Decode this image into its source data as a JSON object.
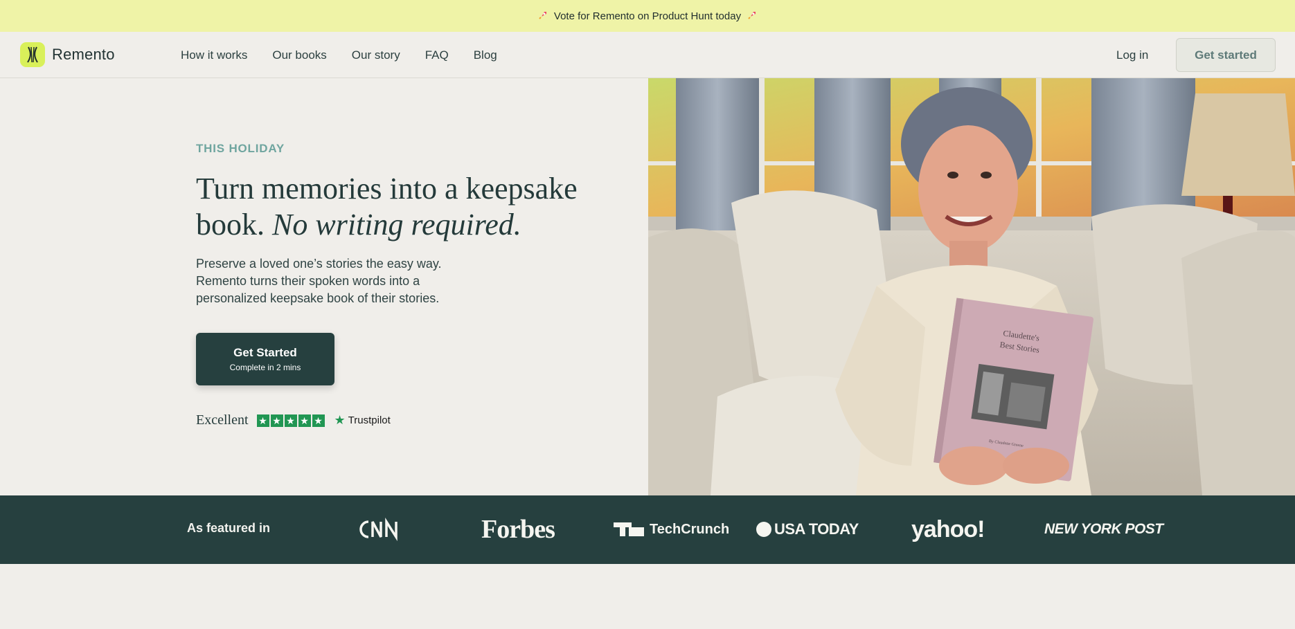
{
  "banner": {
    "text": "Vote for Remento on Product Hunt today"
  },
  "header": {
    "brand": "Remento",
    "nav": [
      "How it works",
      "Our books",
      "Our story",
      "FAQ",
      "Blog"
    ],
    "login": "Log in",
    "cta": "Get started"
  },
  "hero": {
    "eyebrow": "THIS HOLIDAY",
    "headline_plain": "Turn memories into a keepsake book.",
    "headline_italic": "No writing required.",
    "subtext": "Preserve a loved one’s stories the easy way. Remento turns their spoken words into a personalized keepsake book of their stories.",
    "cta_title": "Get Started",
    "cta_sub": "Complete in 2 mins",
    "rating_label": "Excellent",
    "rating_stars": 5,
    "rating_source": "Trustpilot",
    "book_title": "Claudette's Best Stories",
    "book_byline": "By Claudette Greene"
  },
  "featured": {
    "label": "As featured in",
    "outlets": [
      "CNN",
      "Forbes",
      "TechCrunch",
      "USA TODAY",
      "yahoo!",
      "NEW YORK POST"
    ]
  },
  "colors": {
    "banner_bg": "#eff3a7",
    "page_bg": "#f0eeea",
    "brand_dark": "#26403f",
    "accent_teal": "#6fa59f",
    "logo_lime": "#d9f05a",
    "trustpilot_green": "#219653"
  }
}
